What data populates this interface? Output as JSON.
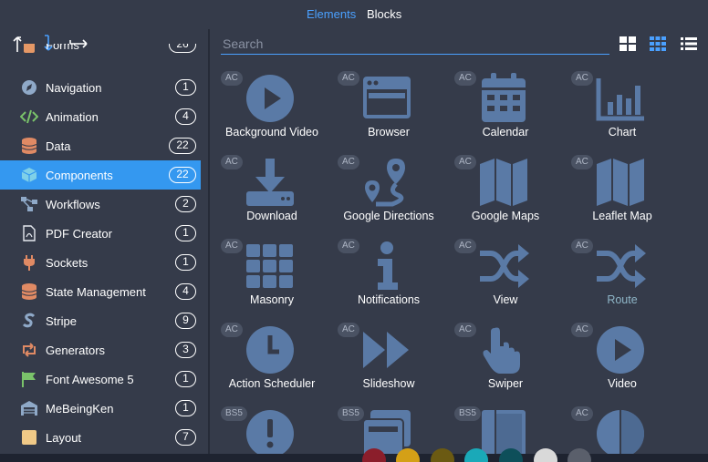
{
  "tabs": [
    {
      "label": "Elements",
      "active": true
    },
    {
      "label": "Blocks",
      "active": false
    }
  ],
  "colors": {
    "accent": "#4aa0ff",
    "active_row": "#3498f0",
    "icon": "#5a7aa6",
    "panel": "#353b4a"
  },
  "left_tools": [
    "arrow-up-icon",
    "arrow-down-icon",
    "arrow-right-icon"
  ],
  "sidebar": {
    "items": [
      {
        "label": "Forms",
        "count": "26",
        "icon": "form-icon"
      },
      {
        "label": "Navigation",
        "count": "1",
        "icon": "compass-icon"
      },
      {
        "label": "Animation",
        "count": "4",
        "icon": "code-icon"
      },
      {
        "label": "Data",
        "count": "22",
        "icon": "database-icon"
      },
      {
        "label": "Components",
        "count": "22",
        "icon": "cube-icon",
        "active": true
      },
      {
        "label": "Workflows",
        "count": "2",
        "icon": "flow-icon"
      },
      {
        "label": "PDF Creator",
        "count": "1",
        "icon": "pdf-icon"
      },
      {
        "label": "Sockets",
        "count": "1",
        "icon": "plug-icon"
      },
      {
        "label": "State Management",
        "count": "4",
        "icon": "database-icon"
      },
      {
        "label": "Stripe",
        "count": "9",
        "icon": "stripe-icon"
      },
      {
        "label": "Generators",
        "count": "3",
        "icon": "retweet-icon"
      },
      {
        "label": "Font Awesome 5",
        "count": "1",
        "icon": "flag-icon"
      },
      {
        "label": "MeBeingKen",
        "count": "1",
        "icon": "warehouse-icon"
      },
      {
        "label": "Layout",
        "count": "7",
        "icon": "square-icon"
      }
    ]
  },
  "search": {
    "placeholder": "Search"
  },
  "view_buttons": [
    "large-grid-icon",
    "small-grid-icon",
    "list-icon"
  ],
  "components": [
    {
      "label": "Background Video",
      "badge": "AC",
      "icon": "play-circle-icon"
    },
    {
      "label": "Browser",
      "badge": "AC",
      "icon": "browser-icon"
    },
    {
      "label": "Calendar",
      "badge": "AC",
      "icon": "calendar-icon"
    },
    {
      "label": "Chart",
      "badge": "AC",
      "icon": "chart-icon"
    },
    {
      "label": "Download",
      "badge": "AC",
      "icon": "download-icon"
    },
    {
      "label": "Google Directions",
      "badge": "AC",
      "icon": "route-pin-icon"
    },
    {
      "label": "Google Maps",
      "badge": "AC",
      "icon": "map-icon"
    },
    {
      "label": "Leaflet Map",
      "badge": "AC",
      "icon": "map-icon"
    },
    {
      "label": "Masonry",
      "badge": "AC",
      "icon": "masonry-icon"
    },
    {
      "label": "Notifications",
      "badge": "AC",
      "icon": "info-icon"
    },
    {
      "label": "View",
      "badge": "AC",
      "icon": "shuffle-icon"
    },
    {
      "label": "Route",
      "badge": "AC",
      "icon": "shuffle-icon"
    },
    {
      "label": "Action Scheduler",
      "badge": "AC",
      "icon": "clock-icon"
    },
    {
      "label": "Slideshow",
      "badge": "AC",
      "icon": "fast-forward-icon"
    },
    {
      "label": "Swiper",
      "badge": "AC",
      "icon": "hand-pointer-icon"
    },
    {
      "label": "Video",
      "badge": "AC",
      "icon": "play-circle-icon"
    },
    {
      "label": "",
      "badge": "BS5",
      "icon": "alert-icon"
    },
    {
      "label": "",
      "badge": "BS5",
      "icon": "cards-icon"
    },
    {
      "label": "",
      "badge": "BS5",
      "icon": "panel-icon"
    },
    {
      "label": "",
      "badge": "AC",
      "icon": "half-circle-icon"
    }
  ],
  "palette_colors": [
    "#8b1e2b",
    "#d4a017",
    "#6b5a12",
    "#1aa9b8",
    "#0e4f5a",
    "#d9d9d9",
    "#5a5f6b"
  ]
}
